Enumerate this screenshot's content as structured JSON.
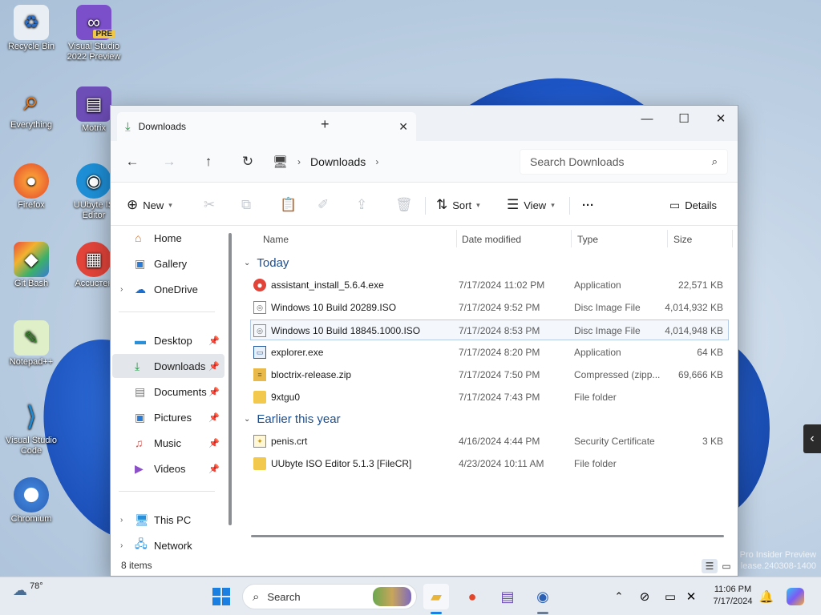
{
  "desktop": {
    "icons": [
      {
        "label": "Recycle Bin"
      },
      {
        "label": "Visual Studio 2022 Preview",
        "badge": "PRE"
      },
      {
        "label": "Everything"
      },
      {
        "label": "Motrix"
      },
      {
        "label": "Firefox"
      },
      {
        "label": "UUbyte IS Editor"
      },
      {
        "label": "Git Bash"
      },
      {
        "label": "Accucтен"
      },
      {
        "label": "Notepad++"
      },
      {
        "label": "Visual Studio Code"
      },
      {
        "label": "Chromium"
      }
    ],
    "watermark_line1": "Pro Insider Preview",
    "watermark_line2": "lease.240308-1400"
  },
  "window": {
    "tab_title": "Downloads",
    "breadcrumb": [
      "Downloads"
    ],
    "search_placeholder": "Search Downloads",
    "toolbar": {
      "new_label": "New",
      "sort_label": "Sort",
      "view_label": "View",
      "more_label": "···",
      "details_label": "Details"
    },
    "nav": {
      "home": "Home",
      "gallery": "Gallery",
      "onedrive": "OneDrive",
      "desktop": "Desktop",
      "downloads": "Downloads",
      "documents": "Documents",
      "pictures": "Pictures",
      "music": "Music",
      "videos": "Videos",
      "thispc": "This PC",
      "network": "Network"
    },
    "columns": {
      "name": "Name",
      "date": "Date modified",
      "type": "Type",
      "size": "Size"
    },
    "groups": {
      "today": {
        "label": "Today",
        "files": [
          {
            "name": "assistant_install_5.6.4.exe",
            "date": "7/17/2024 11:02 PM",
            "type": "Application",
            "size": "22,571 KB",
            "icon": "app-red-icon"
          },
          {
            "name": "Windows 10 Build 20289.ISO",
            "date": "7/17/2024 9:52 PM",
            "type": "Disc Image File",
            "size": "4,014,932 KB",
            "icon": "iso-file-icon"
          },
          {
            "name": "Windows 10 Build 18845.1000.ISO",
            "date": "7/17/2024 8:53 PM",
            "type": "Disc Image File",
            "size": "4,014,948 KB",
            "icon": "iso-file-icon"
          },
          {
            "name": "explorer.exe",
            "date": "7/17/2024 8:20 PM",
            "type": "Application",
            "size": "64 KB",
            "icon": "exe-window-icon"
          },
          {
            "name": "bloctrix-release.zip",
            "date": "7/17/2024 7:50 PM",
            "type": "Compressed (zipp...",
            "size": "69,666 KB",
            "icon": "zip-folder-icon"
          },
          {
            "name": "9xtgu0",
            "date": "7/17/2024 7:43 PM",
            "type": "File folder",
            "size": "",
            "icon": "folder-icon"
          }
        ]
      },
      "earlier": {
        "label": "Earlier this year",
        "files": [
          {
            "name": "penis.crt",
            "date": "4/16/2024 4:44 PM",
            "type": "Security Certificate",
            "size": "3 KB",
            "icon": "certificate-icon"
          },
          {
            "name": "UUbyte ISO Editor 5.1.3 [FileCR]",
            "date": "4/23/2024 10:11 AM",
            "type": "File folder",
            "size": "",
            "icon": "folder-icon"
          }
        ]
      }
    },
    "status": "8 items"
  },
  "taskbar": {
    "temperature": "78°",
    "search_label": "Search",
    "time": "11:06 PM",
    "date": "7/17/2024"
  }
}
